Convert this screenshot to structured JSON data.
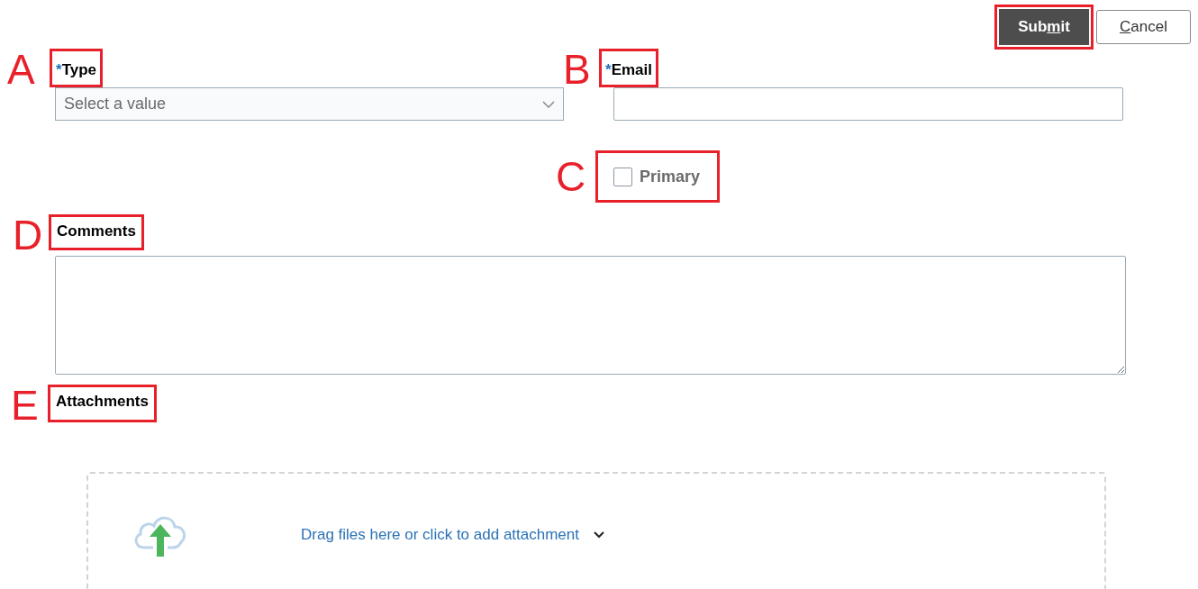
{
  "actions": [
    {
      "kind": "primary",
      "before": "Sub",
      "key": "m",
      "after": "it",
      "highlighted": true
    },
    {
      "kind": "secondary",
      "key": "C",
      "after": "ancel",
      "highlighted": false
    }
  ],
  "fields": [
    {
      "kind": "select",
      "label": "Type",
      "required_mark": "*",
      "placeholder": "Select a value",
      "callout": "A"
    },
    {
      "kind": "text",
      "label": "Email",
      "required_mark": "*",
      "callout": "B"
    }
  ],
  "primary_checkbox": {
    "label": "Primary",
    "checked": false,
    "callout": "C"
  },
  "comments": {
    "label": "Comments",
    "callout": "D"
  },
  "attachments": {
    "label": "Attachments",
    "callout": "E",
    "dropzone_text": "Drag files here or click to add attachment"
  }
}
